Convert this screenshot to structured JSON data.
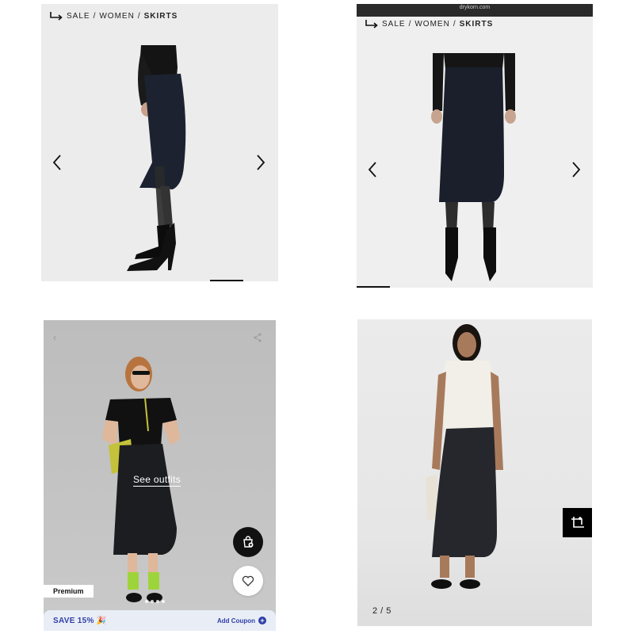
{
  "panel1": {
    "breadcrumb": {
      "sale": "SALE",
      "sep1": "/",
      "women": "WOMEN",
      "sep2": "/",
      "skirts": "SKIRTS"
    }
  },
  "panel2": {
    "site": "drykorn.com",
    "breadcrumb": {
      "sale": "SALE",
      "sep1": "/",
      "women": "WOMEN",
      "sep2": "/",
      "skirts": "SKIRTS"
    }
  },
  "panel3": {
    "see_outfits": "See outfits",
    "premium_badge": "Premium",
    "coupon": {
      "save": "SAVE 15% 🎉",
      "add": "Add Coupon",
      "plus": "+"
    },
    "icons": [
      "back-icon",
      "share-icon",
      "bag-plus-icon",
      "heart-icon"
    ]
  },
  "panel4": {
    "counter": "2 / 5"
  },
  "colors": {
    "coupon_text": "#2f3fa8",
    "coupon_bg": "#e9edf6",
    "skirt": "#1b1e24"
  }
}
